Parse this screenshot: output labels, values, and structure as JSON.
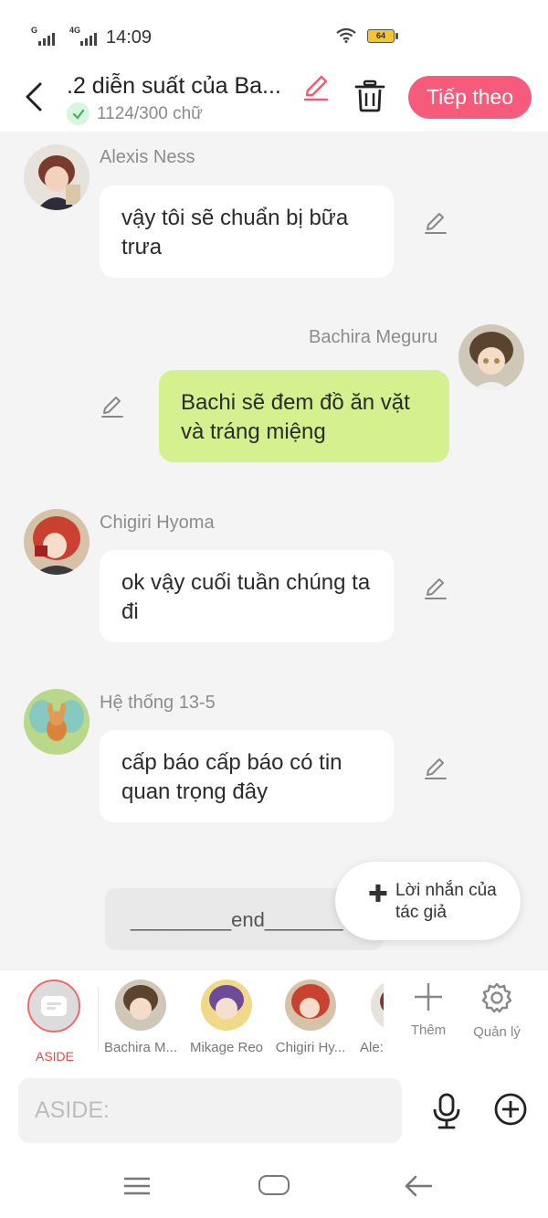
{
  "status_bar": {
    "signal1_tag": "G",
    "signal2_tag": "4G",
    "time": "14:09",
    "battery": "64"
  },
  "header": {
    "title": ".2 diễn suất của Ba...",
    "word_count": "1124/300 chữ",
    "next_label": "Tiếp theo"
  },
  "messages": [
    {
      "sender": "Alexis Ness",
      "text": "vậy tôi sẽ chuẩn bị bữa trưa"
    },
    {
      "sender": "Bachira Meguru",
      "text": "Bachi sẽ đem đồ ăn vặt và tráng miệng"
    },
    {
      "sender": "Chigiri Hyoma",
      "text": "ok vậy cuối tuần chúng ta đi"
    },
    {
      "sender": "Hệ thống 13-5",
      "text": "cấp báo cấp báo có tin quan trọng đây"
    }
  ],
  "end_text": "_________end_______",
  "author_note": "Lời nhắn của tác giả",
  "character_bar": {
    "aside_label": "ASIDE",
    "characters": [
      "Bachira M...",
      "Mikage Reo",
      "Chigiri Hy...",
      "Ale:"
    ],
    "add_label": "Thêm",
    "manage_label": "Quản lý"
  },
  "input": {
    "placeholder": "ASIDE:"
  },
  "colors": {
    "accent": "#f75b7b",
    "my_bubble": "#d4f08f",
    "chat_bg": "#f4f4f4"
  }
}
